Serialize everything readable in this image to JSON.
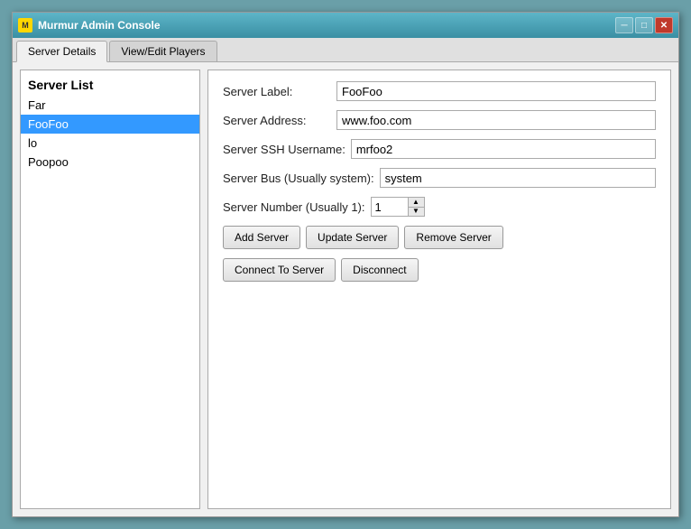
{
  "window": {
    "title": "Murmur Admin Console",
    "icon": "M"
  },
  "title_controls": {
    "minimize": "─",
    "maximize": "□",
    "close": "✕"
  },
  "tabs": [
    {
      "id": "server-details",
      "label": "Server Details",
      "active": true
    },
    {
      "id": "view-edit-players",
      "label": "View/Edit Players",
      "active": false
    }
  ],
  "server_list": {
    "title": "Server List",
    "items": [
      {
        "name": "Far",
        "selected": false
      },
      {
        "name": "FooFoo",
        "selected": true
      },
      {
        "name": "lo",
        "selected": false
      },
      {
        "name": "Poopoo",
        "selected": false
      }
    ]
  },
  "details": {
    "server_label_label": "Server Label:",
    "server_label_value": "FooFoo",
    "server_address_label": "Server Address:",
    "server_address_value": "www.foo.com",
    "server_ssh_label": "Server SSH Username:",
    "server_ssh_value": "mrfoo2",
    "server_bus_label": "Server Bus (Usually system):",
    "server_bus_value": "system",
    "server_number_label": "Server Number (Usually 1):",
    "server_number_value": "1"
  },
  "buttons": {
    "add_server": "Add Server",
    "update_server": "Update Server",
    "remove_server": "Remove Server",
    "connect": "Connect To Server",
    "disconnect": "Disconnect"
  }
}
